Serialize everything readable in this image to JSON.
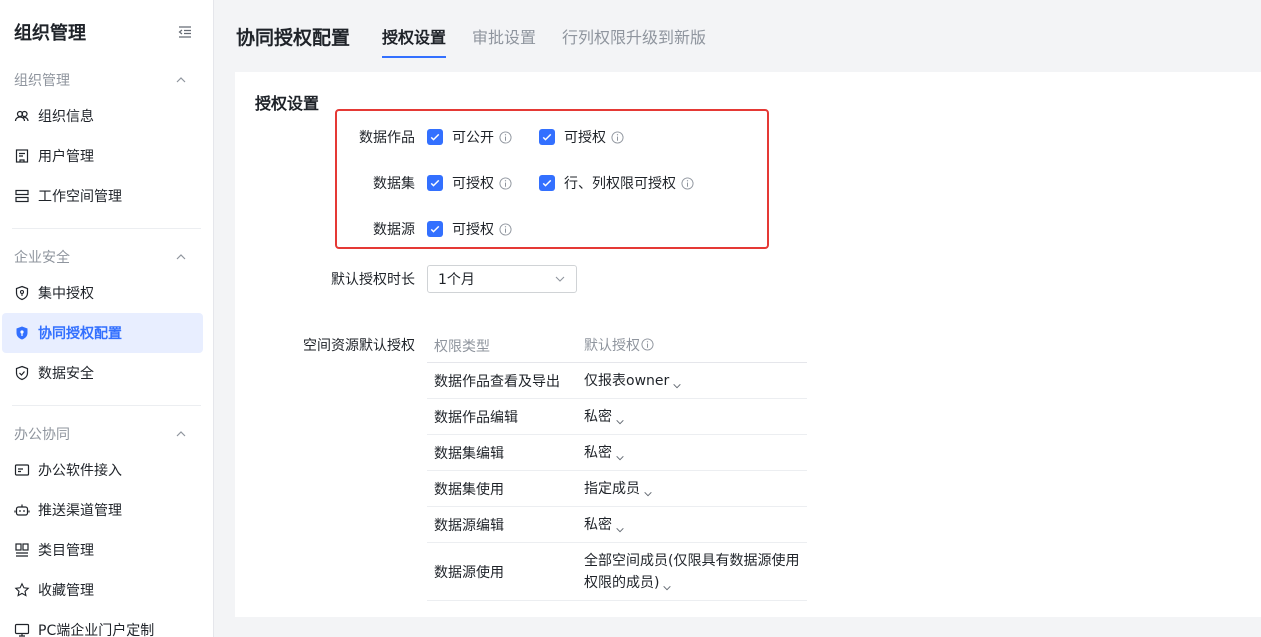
{
  "sidebar": {
    "title": "组织管理",
    "groups": [
      {
        "label": "组织管理",
        "items": [
          {
            "label": "组织信息"
          },
          {
            "label": "用户管理"
          },
          {
            "label": "工作空间管理"
          }
        ]
      },
      {
        "label": "企业安全",
        "items": [
          {
            "label": "集中授权"
          },
          {
            "label": "协同授权配置"
          },
          {
            "label": "数据安全"
          }
        ]
      },
      {
        "label": "办公协同",
        "items": [
          {
            "label": "办公软件接入"
          },
          {
            "label": "推送渠道管理"
          },
          {
            "label": "类目管理"
          },
          {
            "label": "收藏管理"
          },
          {
            "label": "PC端企业门户定制"
          }
        ]
      }
    ],
    "active_item": "协同授权配置"
  },
  "header": {
    "title": "协同授权配置",
    "tabs": [
      {
        "label": "授权设置"
      },
      {
        "label": "审批设置"
      },
      {
        "label": "行列权限升级到新版"
      }
    ],
    "active_tab": "授权设置"
  },
  "auth": {
    "section_title": "授权设置",
    "rows": [
      {
        "label": "数据作品",
        "options": [
          {
            "label": "可公开",
            "checked": true
          },
          {
            "label": "可授权",
            "checked": true
          }
        ]
      },
      {
        "label": "数据集",
        "options": [
          {
            "label": "可授权",
            "checked": true
          },
          {
            "label": "行、列权限可授权",
            "checked": true
          }
        ]
      },
      {
        "label": "数据源",
        "options": [
          {
            "label": "可授权",
            "checked": true
          }
        ]
      }
    ],
    "duration_label": "默认授权时长",
    "duration_value": "1个月",
    "space_label": "空间资源默认授权"
  },
  "table": {
    "headers": [
      "权限类型",
      "默认授权"
    ],
    "rows": [
      {
        "type": "数据作品查看及导出",
        "value": "仅报表owner"
      },
      {
        "type": "数据作品编辑",
        "value": "私密"
      },
      {
        "type": "数据集编辑",
        "value": "私密"
      },
      {
        "type": "数据集使用",
        "value": "指定成员"
      },
      {
        "type": "数据源编辑",
        "value": "私密"
      },
      {
        "type": "数据源使用",
        "value": "全部空间成员(仅限具有数据源使用权限的成员)"
      }
    ]
  },
  "colors": {
    "accent": "#3370ff",
    "highlight_box": "#e53935",
    "active_bg": "#e8eeff"
  }
}
